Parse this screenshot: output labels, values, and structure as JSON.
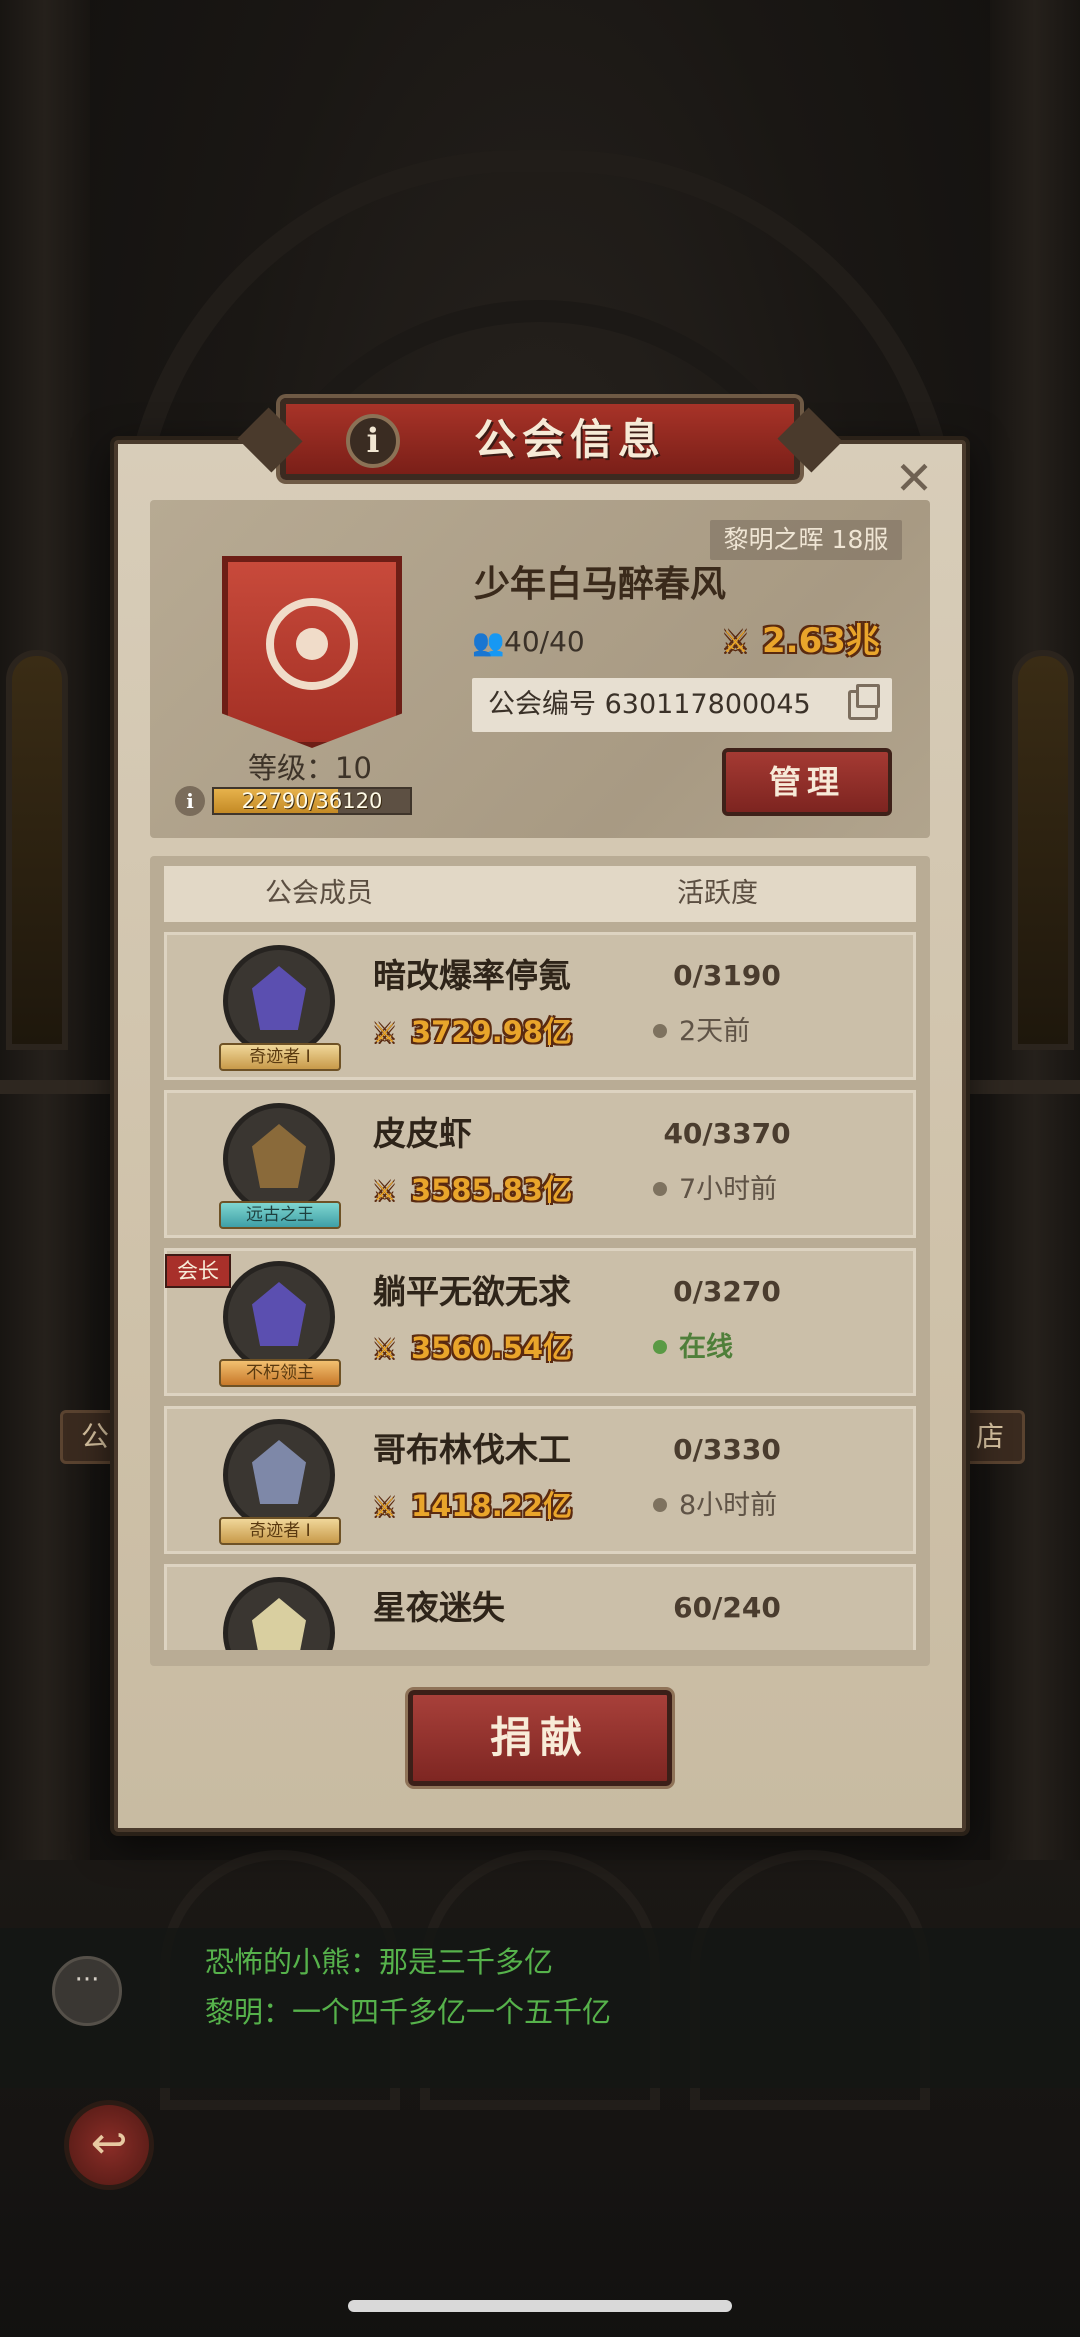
{
  "dialog": {
    "title": "公会信息",
    "info_icon": "i",
    "close_icon": "✕"
  },
  "guild": {
    "server": "黎明之晖 18服",
    "name": "少年白马醉春风",
    "members_count": "40/40",
    "power": "2.63兆",
    "id_label": "公会编号 630117800045",
    "level": "等级：10",
    "xp_text": "22790/36120",
    "xp_fraction": 0.631,
    "manage_label": "管理"
  },
  "list": {
    "header_members": "公会成员",
    "header_activity": "活跃度",
    "leader_tag": "会长",
    "members": [
      {
        "name": "暗改爆率停氪",
        "power": "3729.98亿",
        "activity": "0/3190",
        "status": "2天前",
        "online": false,
        "badge": "奇迹者 I",
        "avatar_color": "#5b4fb0"
      },
      {
        "name": "皮皮虾",
        "power": "3585.83亿",
        "activity": "40/3370",
        "status": "7小时前",
        "online": false,
        "badge": "远古之王",
        "avatar_color": "#8a6a3a"
      },
      {
        "name": "躺平无欲无求",
        "power": "3560.54亿",
        "activity": "0/3270",
        "status": "在线",
        "online": true,
        "badge": "不朽领主",
        "avatar_color": "#5b4fb0"
      },
      {
        "name": "哥布林伐木工",
        "power": "1418.22亿",
        "activity": "0/3330",
        "status": "8小时前",
        "online": false,
        "badge": "奇迹者 I",
        "avatar_color": "#7e88a8"
      },
      {
        "name": "星夜迷失",
        "power": "",
        "activity": "60/240",
        "status": "",
        "online": false,
        "badge": "",
        "avatar_color": "#d9cfa0"
      }
    ]
  },
  "donate_label": "捐献",
  "chat": {
    "line1": "恐怖的小熊：那是三千多亿",
    "line2": "黎明：一个四千多亿一个五千亿"
  },
  "scene_signs": {
    "left": "公",
    "right": "店"
  },
  "icons": {
    "sword": "⚔",
    "members": "👥",
    "back": "↩"
  }
}
